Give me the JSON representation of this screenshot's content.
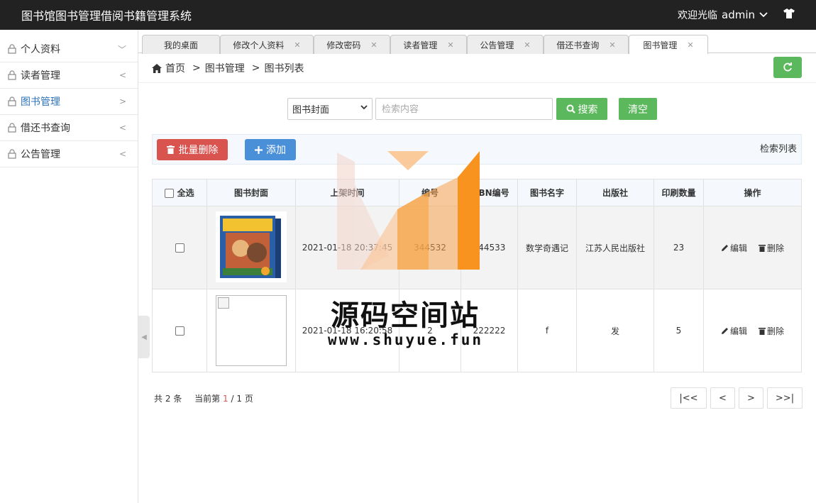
{
  "header": {
    "app_title": "图书馆图书管理借阅书籍管理系统",
    "welcome": "欢迎光临",
    "user": "admin"
  },
  "sidebar": {
    "items": [
      {
        "label": "个人资料",
        "arrow": "﹀"
      },
      {
        "label": "读者管理",
        "arrow": "<"
      },
      {
        "label": "图书管理",
        "arrow": ">"
      },
      {
        "label": "借还书查询",
        "arrow": "<"
      },
      {
        "label": "公告管理",
        "arrow": "<"
      }
    ]
  },
  "tabs": [
    {
      "label": "我的桌面"
    },
    {
      "label": "修改个人资料"
    },
    {
      "label": "修改密码"
    },
    {
      "label": "读者管理"
    },
    {
      "label": "公告管理"
    },
    {
      "label": "借还书查询"
    },
    {
      "label": "图书管理"
    }
  ],
  "breadcrumb": {
    "home": "首页",
    "level1": "图书管理",
    "level2": "图书列表"
  },
  "search": {
    "field_selected": "图书封面",
    "placeholder": "检索内容",
    "search_label": "搜索",
    "clear_label": "清空"
  },
  "actions": {
    "batch_delete": "批量删除",
    "add": "添加",
    "list_label": "检索列表"
  },
  "table": {
    "select_all": "全选",
    "headers": [
      "图书封面",
      "上架时间",
      "编号",
      "ISBN编号",
      "图书名字",
      "出版社",
      "印刷数量",
      "操作"
    ],
    "rows": [
      {
        "time": "2021-01-18 20:37:45",
        "id": "344532",
        "isbn": "344533",
        "name": "数学奇遇记",
        "publisher": "江苏人民出版社",
        "count": "23"
      },
      {
        "time": "2021-01-18 16:20:58",
        "id": "2",
        "isbn": "222222",
        "name": "f",
        "publisher": "发",
        "count": "5"
      }
    ],
    "edit_label": "编辑",
    "delete_label": "删除"
  },
  "pager": {
    "total_prefix": "共",
    "total": "2",
    "total_suffix": "条",
    "page_prefix": "当前第",
    "current": "1",
    "page_sep": "/",
    "pages": "1",
    "page_suffix": "页",
    "first": "|<<",
    "prev": "<",
    "next": ">",
    "last": ">>|"
  },
  "watermark": {
    "title": "源码空间站",
    "url": "www.shuyue.fun"
  },
  "colors": {
    "header_bg": "#222222",
    "green": "#5cb85c",
    "red": "#d9534f",
    "blue": "#4a90d9",
    "active_link": "#2e73b8",
    "watermark_orange": "#f7931e"
  }
}
